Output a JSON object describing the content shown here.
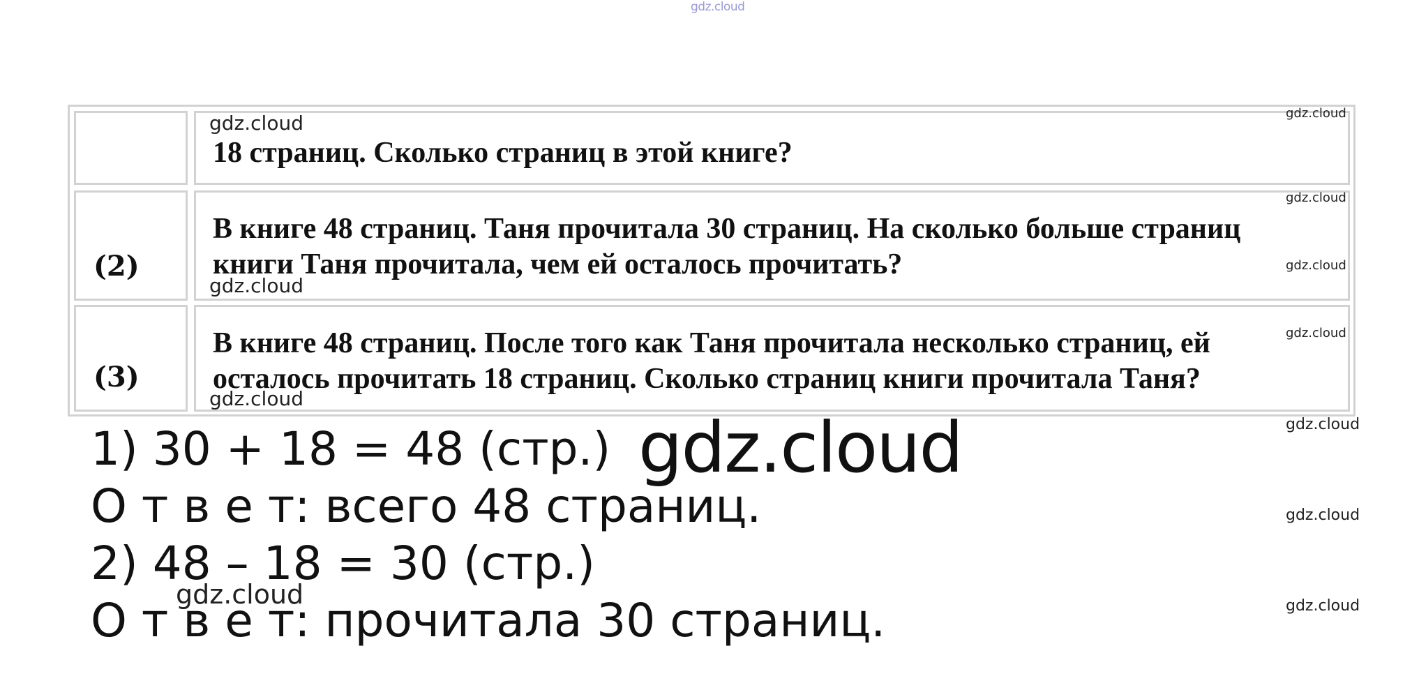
{
  "watermark": "gdz.cloud",
  "tasks": [
    {
      "number": "",
      "lines": [
        "18 страниц. Сколько страниц в этой книге?"
      ]
    },
    {
      "number": "(2)",
      "lines": [
        "В книге 48 страниц. Таня прочитала 30 страниц. На сколько больше страниц",
        "книги Таня прочитала, чем ей осталось прочитать?"
      ]
    },
    {
      "number": "(3)",
      "lines": [
        "В книге 48 страниц. После того как Таня прочитала несколько страниц, ей",
        "осталось прочитать 18 страниц. Сколько страниц книги прочитала Таня?"
      ]
    }
  ],
  "answers": [
    "1) 30 + 18 = 48 (стр.)",
    "О т в е т: всего 48 страниц.",
    "2) 48 – 18 = 30 (стр.)",
    "О т в е т: прочитала 30 страниц."
  ]
}
